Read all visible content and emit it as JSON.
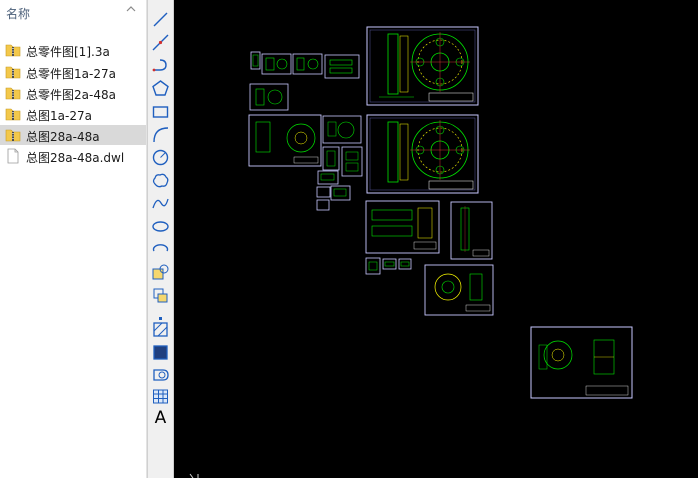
{
  "explorer": {
    "header": {
      "label": "名称",
      "chevron_icon": "chevron-up-icon"
    },
    "files": [
      {
        "name": "总零件图[1].3a",
        "icon": "zip-folder-icon",
        "selected": false
      },
      {
        "name": "总零件图1a-27a",
        "icon": "zip-folder-icon",
        "selected": false
      },
      {
        "name": "总零件图2a-48a",
        "icon": "zip-folder-icon",
        "selected": false
      },
      {
        "name": "总图1a-27a",
        "icon": "zip-folder-icon",
        "selected": false
      },
      {
        "name": "总图28a-48a",
        "icon": "zip-folder-icon",
        "selected": true
      },
      {
        "name": "总图28a-48a.dwl",
        "icon": "file-icon",
        "selected": false
      }
    ]
  },
  "toolbar": {
    "tools": [
      {
        "id": "line",
        "icon": "line-icon"
      },
      {
        "id": "construction-line",
        "icon": "construction-line-icon"
      },
      {
        "id": "polyline",
        "icon": "polyline-icon"
      },
      {
        "id": "polygon",
        "icon": "polygon-icon"
      },
      {
        "id": "rectangle",
        "icon": "rectangle-icon"
      },
      {
        "id": "arc",
        "icon": "arc-icon"
      },
      {
        "id": "circle",
        "icon": "circle-icon"
      },
      {
        "id": "revision-cloud",
        "icon": "revision-cloud-icon"
      },
      {
        "id": "spline",
        "icon": "spline-icon"
      },
      {
        "id": "ellipse",
        "icon": "ellipse-icon"
      },
      {
        "id": "ellipse-arc",
        "icon": "ellipse-arc-icon"
      },
      {
        "id": "insert-block",
        "icon": "insert-block-icon"
      },
      {
        "id": "make-block",
        "icon": "make-block-icon"
      },
      {
        "id": "point",
        "icon": "point-icon"
      },
      {
        "id": "hatch",
        "icon": "hatch-icon"
      },
      {
        "id": "gradient",
        "icon": "gradient-icon"
      },
      {
        "id": "region",
        "icon": "region-icon"
      },
      {
        "id": "table",
        "icon": "table-icon"
      },
      {
        "id": "multiline-text",
        "icon": "multiline-text-icon",
        "label": "A"
      }
    ]
  },
  "canvas": {
    "background": "#000000",
    "frame_color": "#c8c8ff",
    "line_color": "#00e600",
    "accent_color": "#ffff00"
  }
}
